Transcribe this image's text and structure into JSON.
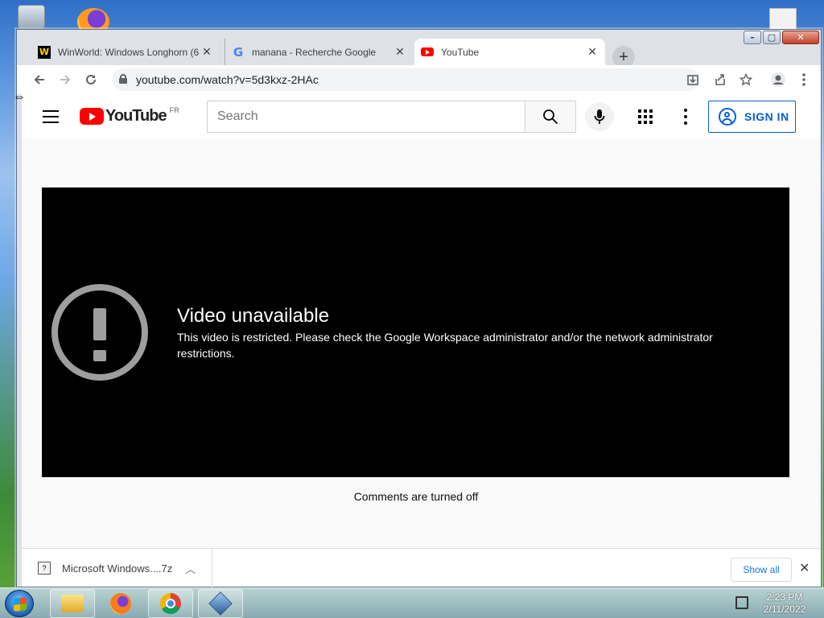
{
  "browser": {
    "tabs": [
      {
        "label": "WinWorld: Windows Longhorn (6",
        "favicon": "winworld-icon",
        "active": false
      },
      {
        "label": "manana - Recherche Google",
        "favicon": "google-icon",
        "active": false
      },
      {
        "label": "YouTube",
        "favicon": "youtube-icon",
        "active": true
      }
    ],
    "new_tab_glyph": "+",
    "url": "youtube.com/watch?v=5d3kxz-2HAc"
  },
  "youtube": {
    "logo_text": "YouTube",
    "region": "FR",
    "search_placeholder": "Search",
    "sign_in_label": "SIGN IN",
    "error_title": "Video unavailable",
    "error_message": "This video is restricted. Please check the Google Workspace administrator and/or the network administrator restrictions.",
    "comments_text": "Comments are turned off"
  },
  "downloads": {
    "item_name": "Microsoft Windows....7z",
    "show_all_label": "Show all"
  },
  "taskbar": {
    "time": "2:23 PM",
    "date": "2/11/2022",
    "apps": [
      "file-explorer-icon",
      "firefox-icon",
      "chrome-icon",
      "virtualbox-icon"
    ]
  },
  "colors": {
    "youtube_red": "#ff0000",
    "sign_in_blue": "#065fd4",
    "player_bg": "#000000",
    "link_blue": "#1a73e8"
  }
}
